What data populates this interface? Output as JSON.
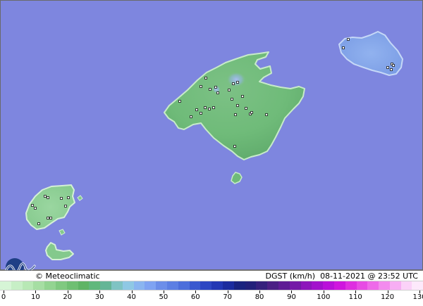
{
  "credit": "© Meteoclimatic",
  "product_label": "DGST (km/h)",
  "timestamp": "08-11-2021 @ 23:52 UTC",
  "colors": {
    "sea": "#7e86df",
    "land_base": "#6cbb7a",
    "land_light": "#a9dfae",
    "island_east": "#86a7ea"
  },
  "legend": {
    "unit": "km/h",
    "min": 0,
    "max": 130,
    "ticks": [
      "0",
      "10",
      "20",
      "30",
      "40",
      "50",
      "60",
      "70",
      "80",
      "90",
      "100",
      "110",
      "120",
      "130"
    ],
    "colors": [
      "#d6f5d6",
      "#c7efc6",
      "#b8e8b5",
      "#a6dea3",
      "#93d491",
      "#80c980",
      "#6fbf72",
      "#5fb465",
      "#60b87c",
      "#64b596",
      "#7fc3c3",
      "#8fc8e4",
      "#8ab5f0",
      "#7fa3f2",
      "#6c8ee9",
      "#5c7fe3",
      "#4c6edb",
      "#3a59cf",
      "#2d46c2",
      "#2338b4",
      "#1c2c9e",
      "#1a237f",
      "#22207a",
      "#35207d",
      "#4b1f85",
      "#5f1c95",
      "#7419a7",
      "#8d16bb",
      "#a212cc",
      "#b911d9",
      "#cf16de",
      "#de2fe0",
      "#e74ce4",
      "#ee6ae9",
      "#f38bee",
      "#f7aef3",
      "#fbd2f8",
      "#fde9fb"
    ]
  },
  "stations": [
    [
      [
        292,
        111
      ],
      [
        285,
        123
      ],
      [
        298,
        127
      ],
      [
        306,
        124
      ],
      [
        309,
        132
      ],
      [
        325,
        128
      ],
      [
        331,
        119
      ],
      [
        337,
        117
      ],
      [
        344,
        137
      ],
      [
        329,
        141
      ],
      [
        337,
        150
      ],
      [
        349,
        154
      ],
      [
        355,
        162
      ],
      [
        357,
        160
      ],
      [
        378,
        163
      ],
      [
        334,
        163
      ],
      [
        303,
        153
      ],
      [
        297,
        155
      ],
      [
        291,
        153
      ],
      [
        285,
        161
      ],
      [
        279,
        156
      ],
      [
        271,
        166
      ],
      [
        255,
        144
      ],
      [
        333,
        208
      ]
    ],
    [
      [
        494,
        56
      ],
      [
        487,
        68
      ],
      [
        550,
        96
      ],
      [
        556,
        91
      ],
      [
        555,
        99
      ],
      [
        558,
        93
      ]
    ],
    [
      [
        64,
        279
      ],
      [
        68,
        281
      ],
      [
        87,
        282
      ],
      [
        97,
        281
      ],
      [
        93,
        293
      ],
      [
        72,
        310
      ],
      [
        68,
        310
      ],
      [
        55,
        318
      ],
      [
        50,
        296
      ],
      [
        46,
        292
      ]
    ]
  ]
}
